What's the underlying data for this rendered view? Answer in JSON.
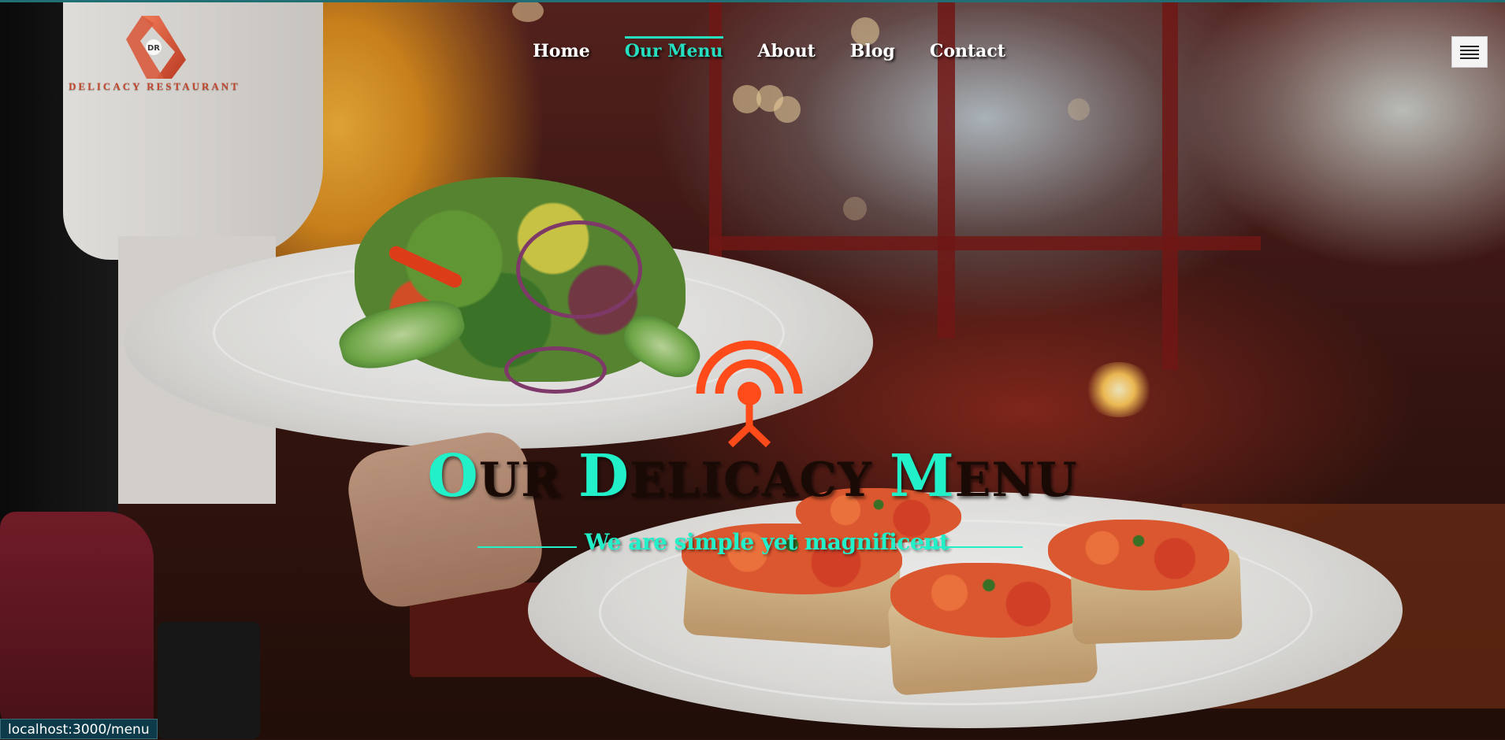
{
  "brand": {
    "name": "DELICACY RESTAURANT",
    "monogram": "DR",
    "accent_color": "#22f0c8",
    "logo_color": "#c4472c"
  },
  "nav": {
    "items": [
      {
        "label": "Home",
        "active": false
      },
      {
        "label": "Our Menu",
        "active": true
      },
      {
        "label": "About",
        "active": false
      },
      {
        "label": "Blog",
        "active": false
      },
      {
        "label": "Contact",
        "active": false
      }
    ],
    "menu_toggle_icon": "hamburger-icon"
  },
  "hero": {
    "icon": "broadcast-icon",
    "icon_color": "#ff4a1a",
    "title_words": [
      {
        "cap": "O",
        "rest": "UR "
      },
      {
        "cap": "D",
        "rest": "ELICACY "
      },
      {
        "cap": "M",
        "rest": "ENU"
      }
    ],
    "subtitle": "We are simple yet magnificent"
  },
  "status_bar": {
    "url": "localhost:3000/menu"
  }
}
